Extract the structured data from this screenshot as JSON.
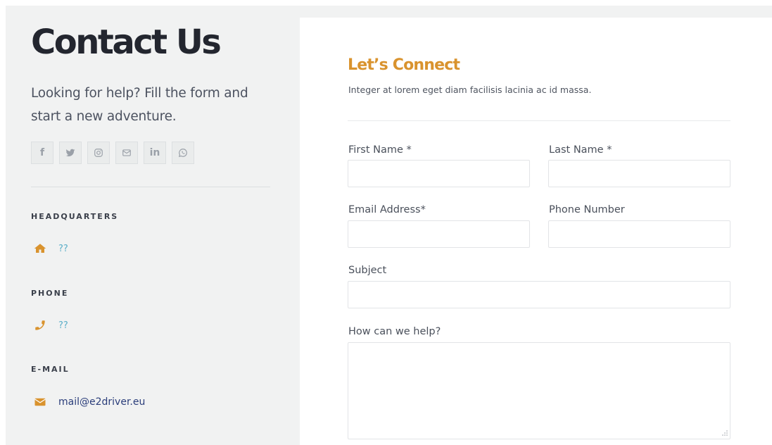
{
  "left": {
    "title": "Contact Us",
    "intro": "Looking for help? Fill the form and start a new adventure.",
    "social": [
      {
        "name": "facebook-icon",
        "glyph": "f"
      },
      {
        "name": "twitter-icon"
      },
      {
        "name": "instagram-icon"
      },
      {
        "name": "envelope-icon"
      },
      {
        "name": "linkedin-icon",
        "glyph": "in"
      },
      {
        "name": "whatsapp-icon"
      }
    ],
    "headquarters": {
      "heading": "HEADQUARTERS",
      "value": "??"
    },
    "phone": {
      "heading": "PHONE",
      "value": "??"
    },
    "email": {
      "heading": "E-MAIL",
      "value": "mail@e2driver.eu"
    }
  },
  "form": {
    "title": "Let’s Connect",
    "subtitle": "Integer at lorem eget diam facilisis lacinia ac id massa.",
    "first_name_label": "First Name *",
    "last_name_label": "Last Name *",
    "email_label": "Email Address*",
    "phone_label": "Phone Number",
    "subject_label": "Subject",
    "message_label": "How can we help?",
    "first_name_value": "",
    "last_name_value": "",
    "email_value": "",
    "phone_value": "",
    "subject_value": "",
    "message_value": ""
  },
  "colors": {
    "accent": "#d9932e",
    "link": "#5aaec8",
    "mail_link": "#2a3d7a",
    "panel_bg": "#f1f2f2",
    "title": "#23262f"
  }
}
